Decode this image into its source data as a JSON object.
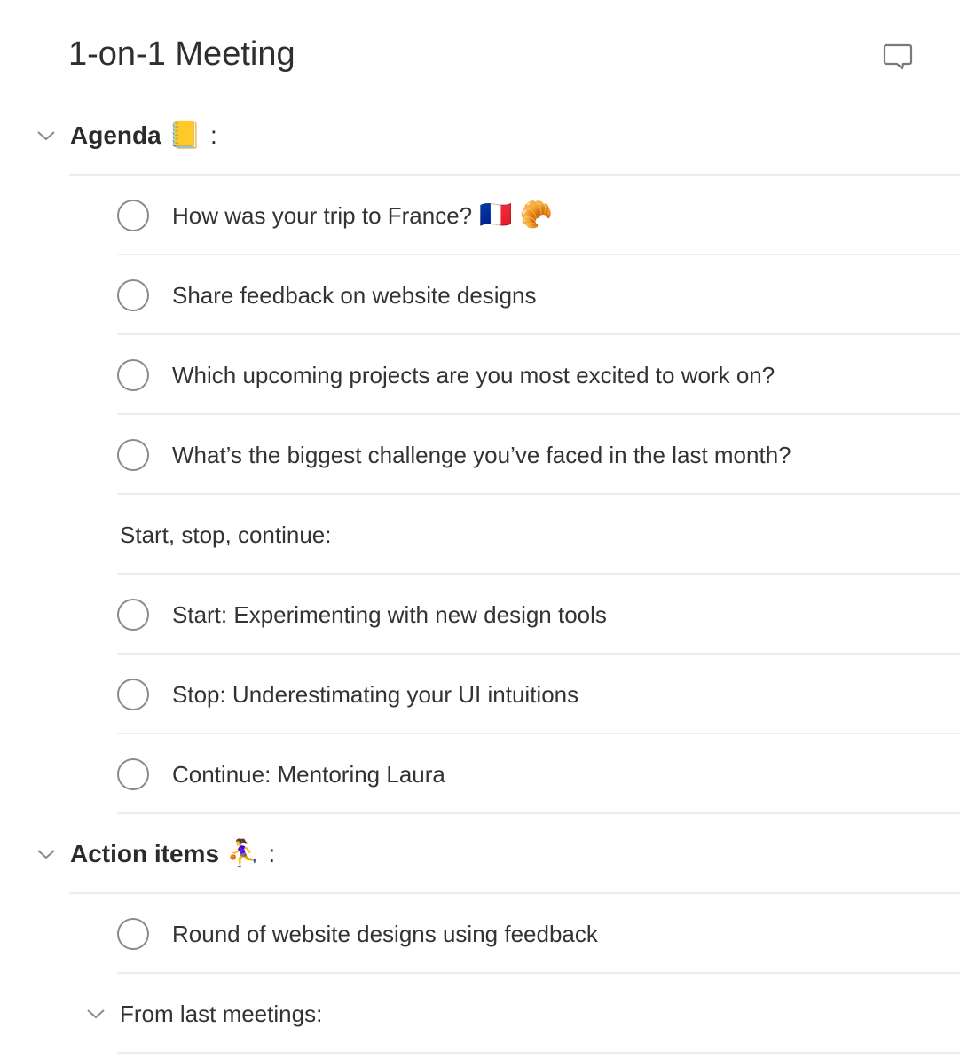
{
  "page": {
    "title": "1-on-1 Meeting",
    "comment_icon": "speech-bubble-icon"
  },
  "sections": [
    {
      "title": "Agenda",
      "emoji": "📒",
      "suffix": ":",
      "collapsed": false
    },
    {
      "title": "Action items",
      "emoji": "⛹️‍♀️",
      "suffix": ":",
      "collapsed": false
    }
  ],
  "agenda_items": [
    {
      "type": "task",
      "text": "How was your trip to France?",
      "emoji": "🇫🇷 🥐",
      "checked": false
    },
    {
      "type": "task",
      "text": "Share feedback on website designs",
      "checked": false
    },
    {
      "type": "task",
      "text": "Which upcoming projects are you most excited to work on?",
      "checked": false
    },
    {
      "type": "task",
      "text": "What’s the biggest challenge you’ve faced in the last month?",
      "checked": false
    },
    {
      "type": "text",
      "text": "Start, stop, continue:"
    },
    {
      "type": "task",
      "text": "Start: Experimenting with new design tools",
      "checked": false
    },
    {
      "type": "task",
      "text": "Stop: Underestimating your UI intuitions",
      "checked": false
    },
    {
      "type": "task",
      "text": "Continue: Mentoring Laura",
      "checked": false
    }
  ],
  "action_items": [
    {
      "type": "task",
      "text": "Round of website designs using feedback",
      "checked": false
    },
    {
      "type": "subsection",
      "text": "From last meetings:",
      "collapsed": false
    }
  ],
  "colors": {
    "text": "#333333",
    "separator": "#ededed",
    "checkbox_border": "#8a8a8a",
    "icon": "#7a7a7a"
  }
}
